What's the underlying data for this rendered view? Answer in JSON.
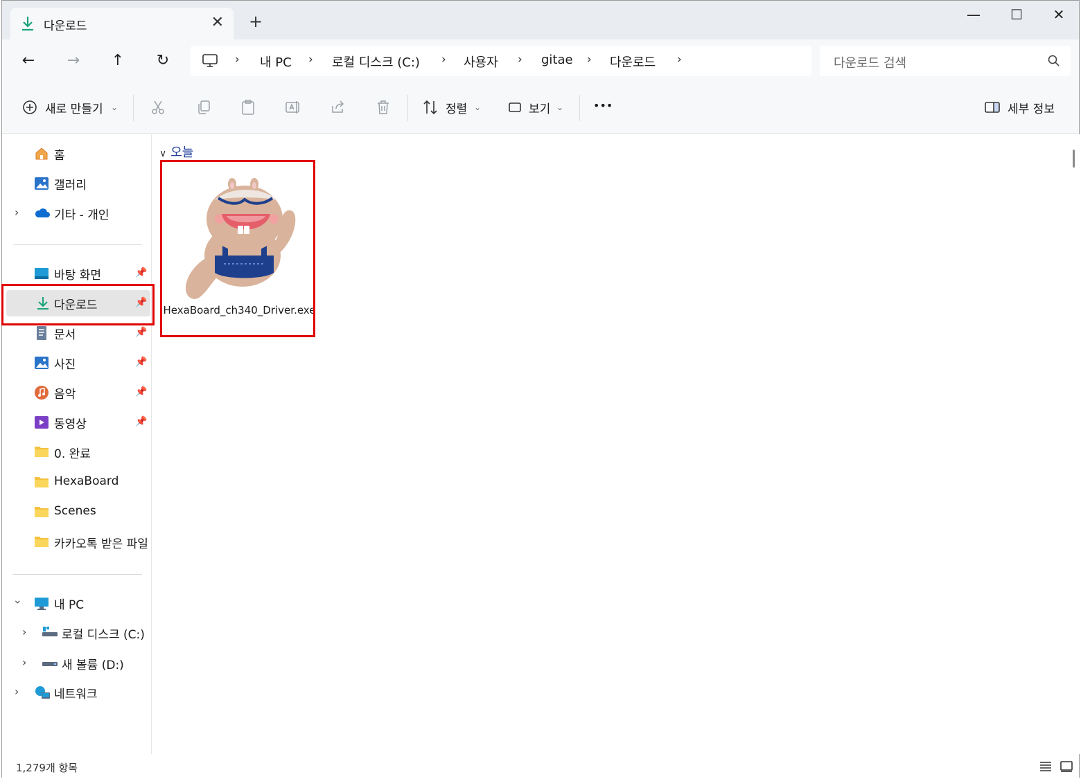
{
  "tab": {
    "title": "다운로드",
    "close": "✕",
    "new_tab": "+"
  },
  "window_controls": {
    "minimize": "—",
    "maximize": "☐",
    "close": "✕"
  },
  "nav": {
    "back": "←",
    "forward": "→",
    "up": "↑",
    "refresh": "↻"
  },
  "breadcrumb": [
    "내 PC",
    "로컬 디스크 (C:)",
    "사용자",
    "gitae",
    "다운로드"
  ],
  "breadcrumb_sep": "›",
  "search": {
    "placeholder": "다운로드 검색"
  },
  "commands": {
    "new": "새로 만들기",
    "sort": "정렬",
    "view": "보기",
    "more": "•••",
    "details": "세부 정보"
  },
  "sidebar": {
    "home": "홈",
    "gallery": "갤러리",
    "cloud": "기타 - 개인",
    "desktop": "바탕 화면",
    "downloads": "다운로드",
    "documents": "문서",
    "pictures": "사진",
    "music": "음악",
    "videos": "동영상",
    "folder1": "0. 완료",
    "folder2": "HexaBoard",
    "folder3": "Scenes",
    "folder4": "카카오톡 받은 파일",
    "this_pc": "내 PC",
    "drive_c": "로컬 디스크 (C:)",
    "drive_d": "새 볼륨 (D:)",
    "network": "네트워크"
  },
  "content": {
    "group": "오늘",
    "file_name": "HexaBoard_ch340_Driver.exe"
  },
  "status": {
    "count": "1,279개 항목"
  },
  "colors": {
    "highlight": "#e00000",
    "accent": "#1f3d99",
    "download_green": "#1aa37a"
  }
}
